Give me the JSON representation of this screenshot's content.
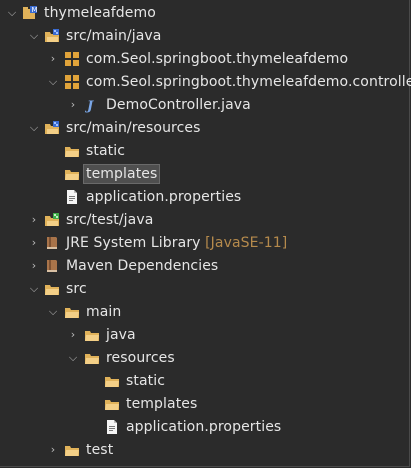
{
  "tree": {
    "project": {
      "label": "thymeleafdemo"
    },
    "src_main_java": {
      "label": "src/main/java"
    },
    "pkg1": {
      "label": "com.Seol.springboot.thymeleafdemo"
    },
    "pkg2": {
      "label": "com.Seol.springboot.thymeleafdemo.controller"
    },
    "democontroller": {
      "label": "DemoController.java"
    },
    "src_main_resources": {
      "label": "src/main/resources"
    },
    "static": {
      "label": "static"
    },
    "templates": {
      "label": "templates"
    },
    "app_props": {
      "label": "application.properties"
    },
    "src_test_java": {
      "label": "src/test/java"
    },
    "jre": {
      "label": "JRE System Library",
      "annotation": "[JavaSE-11]"
    },
    "maven": {
      "label": "Maven Dependencies"
    },
    "src": {
      "label": "src"
    },
    "main": {
      "label": "main"
    },
    "java": {
      "label": "java"
    },
    "resources": {
      "label": "resources"
    },
    "static2": {
      "label": "static"
    },
    "templates2": {
      "label": "templates"
    },
    "app_props2": {
      "label": "application.properties"
    },
    "test": {
      "label": "test"
    }
  },
  "colors": {
    "background": "#2b2b2b",
    "text": "#e6e6e6",
    "folder": "#e0b25a",
    "package": "#e0a33a",
    "java_j": "#7aa6e6",
    "annotation": "#b58a4c",
    "selection": "#4f4f4f"
  }
}
